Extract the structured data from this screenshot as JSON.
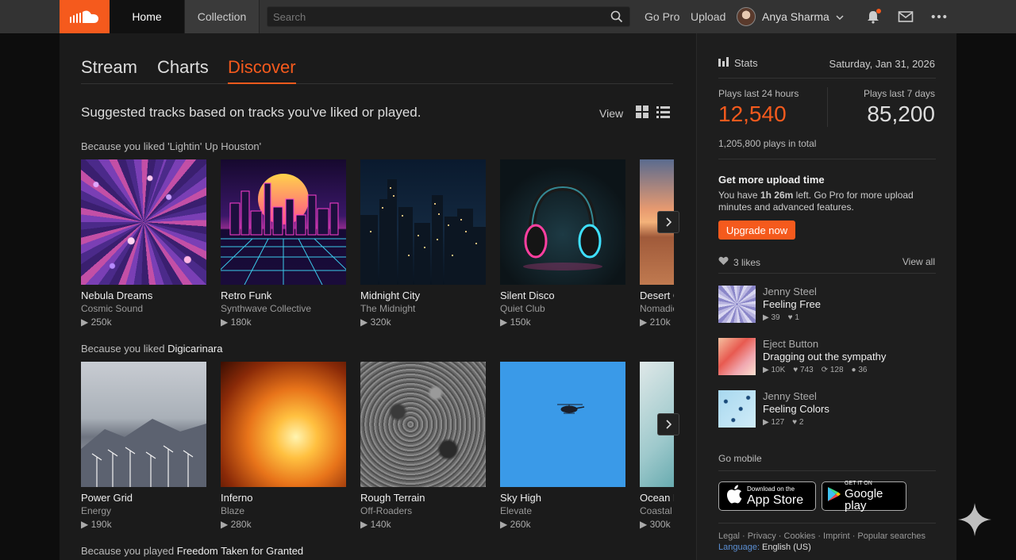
{
  "topbar": {
    "tabs": [
      "Home",
      "Collection"
    ],
    "search_placeholder": "Search",
    "go_pro": "Go Pro",
    "upload": "Upload",
    "username": "Anya Sharma"
  },
  "main": {
    "subtabs": [
      "Stream",
      "Charts",
      "Discover"
    ],
    "heading": "Suggested tracks based on tracks you've liked or played.",
    "view_label": "View",
    "sections": [
      {
        "prefix": "Because you liked ",
        "ref": "'Lightin' Up Houston'",
        "tracks": [
          {
            "title": "Nebula Dreams",
            "artist": "Cosmic Sound",
            "plays": "250k"
          },
          {
            "title": "Retro Funk",
            "artist": "Synthwave Collective",
            "plays": "180k"
          },
          {
            "title": "Midnight City",
            "artist": "The Midnight",
            "plays": "320k"
          },
          {
            "title": "Silent Disco",
            "artist": "Quiet Club",
            "plays": "150k"
          },
          {
            "title": "Desert C",
            "artist": "Nomadic",
            "plays": "210k"
          }
        ]
      },
      {
        "prefix": "Because you liked ",
        "ref": "Digicarinara",
        "tracks": [
          {
            "title": "Power Grid",
            "artist": "Energy",
            "plays": "190k"
          },
          {
            "title": "Inferno",
            "artist": "Blaze",
            "plays": "280k"
          },
          {
            "title": "Rough Terrain",
            "artist": "Off-Roaders",
            "plays": "140k"
          },
          {
            "title": "Sky High",
            "artist": "Elevate",
            "plays": "260k"
          },
          {
            "title": "Ocean D",
            "artist": "Coastal",
            "plays": "300k"
          }
        ]
      },
      {
        "prefix": "Because you played ",
        "ref": "Freedom Taken for Granted"
      }
    ]
  },
  "sidebar": {
    "stats_label": "Stats",
    "date": "Saturday, Jan 31, 2026",
    "plays_24h_label": "Plays last 24 hours",
    "plays_24h": "12,540",
    "plays_7d_label": "Plays last 7 days",
    "plays_7d": "85,200",
    "plays_total": "1,205,800 plays in total",
    "upload_heading": "Get more upload time",
    "upload_text_pre": "You have ",
    "upload_time": "1h 26m",
    "upload_text_post": " left. Go Pro for more upload minutes and advanced features.",
    "upgrade_label": "Upgrade now",
    "likes_label": "3 likes",
    "view_all": "View all",
    "liked": [
      {
        "artist": "Jenny Steel",
        "title": "Feeling Free",
        "plays": "39",
        "likes": "1"
      },
      {
        "artist": "Eject Button",
        "title": "Dragging out the sympathy",
        "plays": "10K",
        "likes": "743",
        "reposts": "128",
        "comments": "36"
      },
      {
        "artist": "Jenny Steel",
        "title": "Feeling Colors",
        "plays": "127",
        "likes": "2"
      }
    ],
    "go_mobile": "Go mobile",
    "appstore_small": "Download on the",
    "appstore_big": "App Store",
    "gplay_small": "GET IT ON",
    "gplay_big": "Google play",
    "footer_links": "Legal · Privacy · Cookies · Imprint · Popular searches",
    "language_label": "Language:",
    "language_value": " English (US)"
  },
  "colors": {
    "accent": "#f55a1d",
    "topbar": "#333333",
    "panel": "#1b1b1b"
  }
}
